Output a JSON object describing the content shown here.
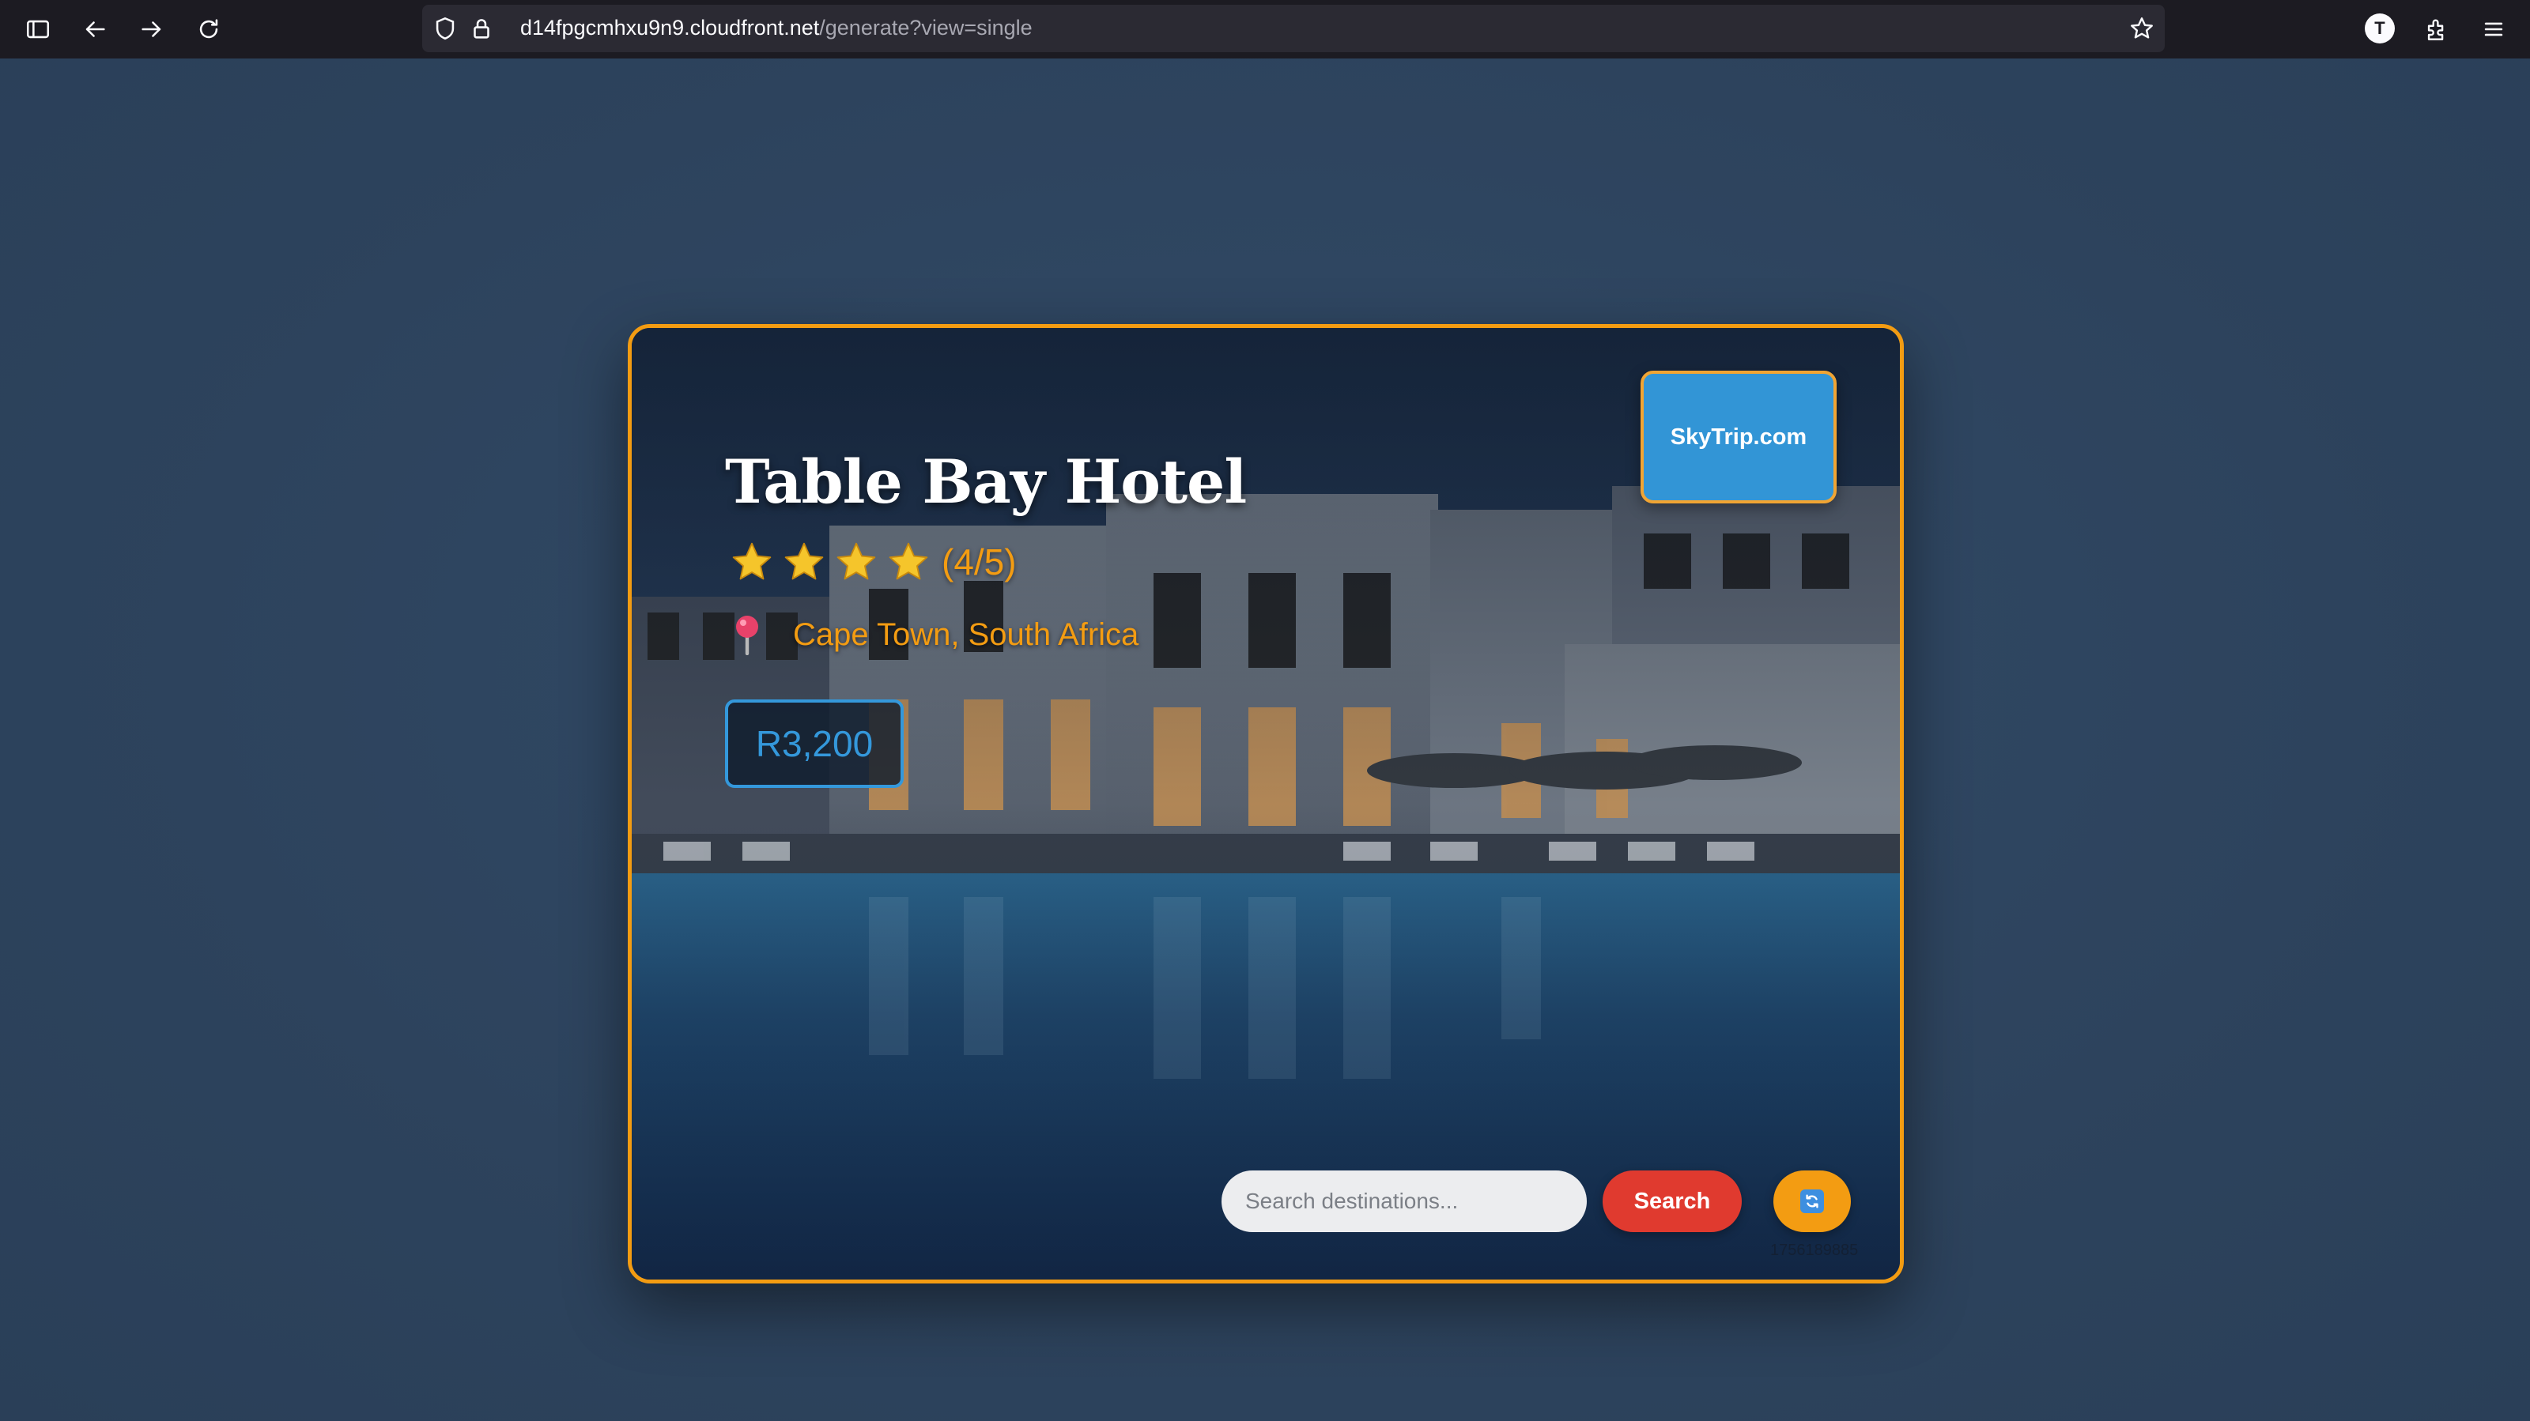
{
  "browser": {
    "url_domain": "d14fpgcmhxu9n9.cloudfront.net",
    "url_path": "/generate?view=single",
    "avatar_letter": "T"
  },
  "ad": {
    "brand": "SkyTrip.com",
    "hotel_name": "Table Bay Hotel",
    "rating_stars": 4,
    "rating_max": 5,
    "rating_text": "(4/5)",
    "location_icon": "pin-icon",
    "location": "Cape Town, South Africa",
    "price": "R3,200",
    "search_placeholder": "Search destinations...",
    "search_label": "Search",
    "refresh_icon": "refresh-icon",
    "footer_id": "1756189885"
  },
  "colors": {
    "accent_orange": "#f39c12",
    "price_blue": "#3498db",
    "brand_blue": "#3295d6",
    "search_red": "#e03a2f",
    "page_bg": "#2e4460"
  }
}
